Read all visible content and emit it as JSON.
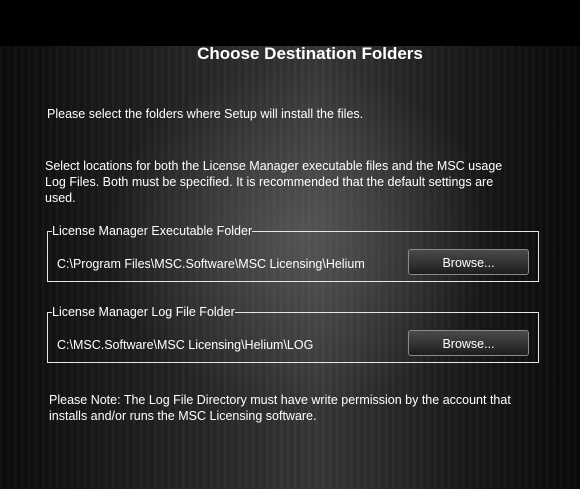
{
  "title": "Choose Destination Folders",
  "intro": "Please select the folders where Setup will install the files.",
  "description": "Select locations for both the License Manager executable files and the MSC usage Log Files. Both must be specified. It is recommended that the default settings are used.",
  "exe_folder": {
    "legend": "License Manager Executable Folder",
    "path": "C:\\Program Files\\MSC.Software\\MSC Licensing\\Helium",
    "browse_label": "Browse..."
  },
  "log_folder": {
    "legend": "License Manager Log File Folder",
    "path": "C:\\MSC.Software\\MSC Licensing\\Helium\\LOG",
    "browse_label": "Browse..."
  },
  "note": "Please Note: The Log File Directory must have write permission by the account that installs and/or runs the MSC Licensing software."
}
